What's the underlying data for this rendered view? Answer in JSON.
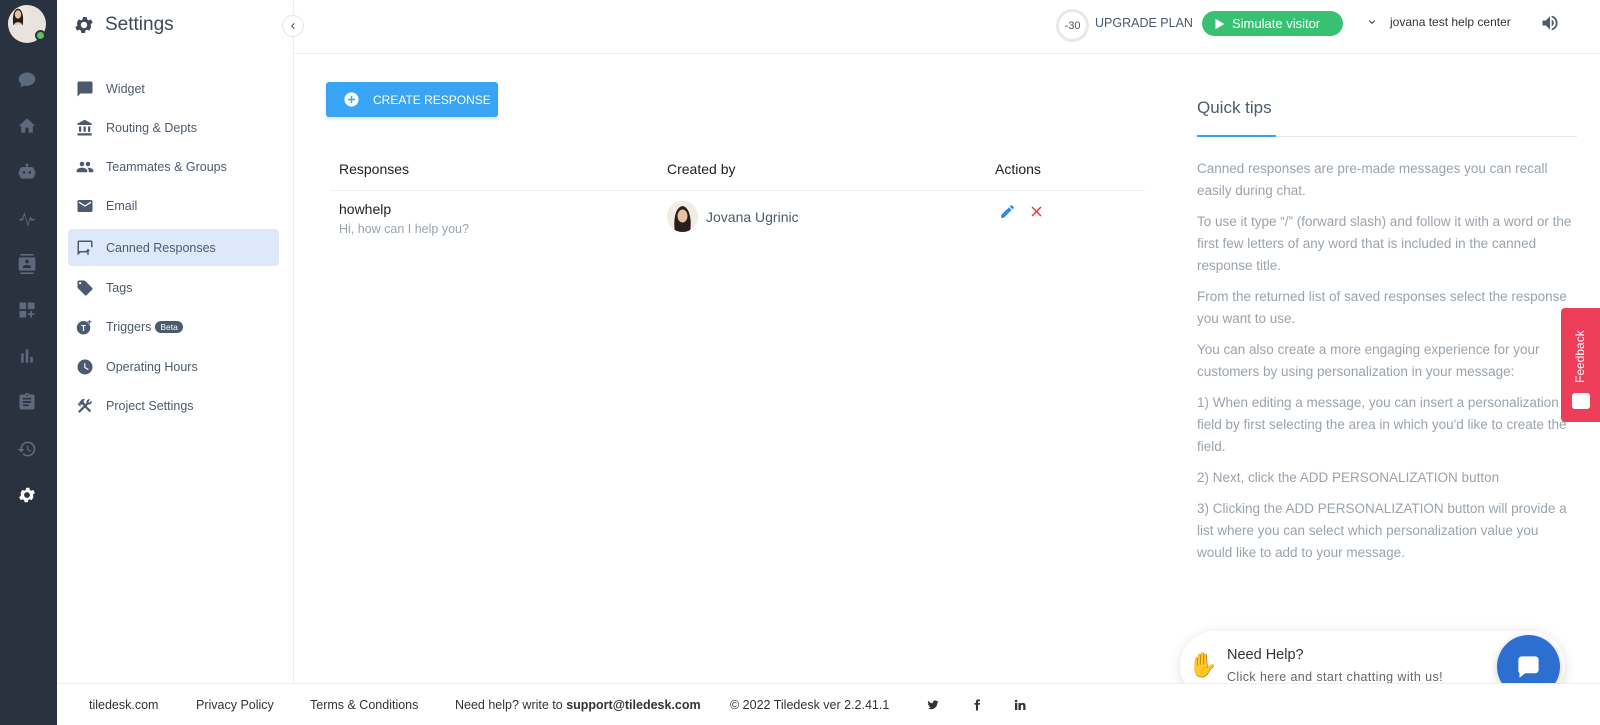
{
  "sidebar_title": "Settings",
  "nav": [
    {
      "label": "Widget",
      "icon": "chat-square-icon"
    },
    {
      "label": "Routing & Depts",
      "icon": "bank-icon"
    },
    {
      "label": "Teammates & Groups",
      "icon": "people-icon"
    },
    {
      "label": "Email",
      "icon": "envelope-icon"
    },
    {
      "label": "Canned Responses",
      "icon": "canned-icon",
      "active": true
    },
    {
      "label": "Tags",
      "icon": "tag-icon"
    },
    {
      "label": "Triggers",
      "icon": "triggers-icon",
      "badge": "Beta"
    },
    {
      "label": "Operating Hours",
      "icon": "clock-icon"
    },
    {
      "label": "Project Settings",
      "icon": "tools-icon"
    }
  ],
  "header": {
    "trial_days": "-30",
    "upgrade_label": "UPGRADE PLAN",
    "simulate_label": "Simulate visitor",
    "project_name": "jovana test help center"
  },
  "main": {
    "create_label": "CREATE RESPONSE",
    "columns": [
      "Responses",
      "Created by",
      "Actions"
    ],
    "rows": [
      {
        "title": "howhelp",
        "text": "Hi, how can I help you?",
        "creator": "Jovana Ugrinic"
      }
    ]
  },
  "tips": {
    "title": "Quick tips",
    "paragraphs": [
      "Canned responses are pre-made messages you can recall easily during chat.",
      "To use it type “/” (forward slash) and follow it with a word or the first few letters of any word that is included in the canned response title.",
      "From the returned list of saved responses select the response you want to use.",
      "You can also create a more engaging experience for your customers by using personalization in your message:",
      "1) When editing a message, you can insert a personalization field by first selecting the area in which you'd like to create the field.",
      "2) Next, click the ADD PERSONALIZATION button",
      "3) Clicking the ADD PERSONALIZATION button will provide a list where you can select which personalization value you would like to add to your message."
    ]
  },
  "feedback_label": "Feedback",
  "help_widget": {
    "title": "Need Help?",
    "subtitle": "Click here and start chatting with us!"
  },
  "footer": {
    "site": "tiledesk.com",
    "privacy": "Privacy Policy",
    "terms": "Terms & Conditions",
    "help_prefix": "Need help? write to",
    "help_email": "support@tiledesk.com",
    "copyright": "© 2022 Tiledesk ver 2.2.41.1"
  },
  "colors": {
    "rail": "#2a3240",
    "accent": "#3aa4f4",
    "simulate": "#38c172",
    "feedback": "#ec3d59",
    "chat": "#2d6fd1"
  }
}
